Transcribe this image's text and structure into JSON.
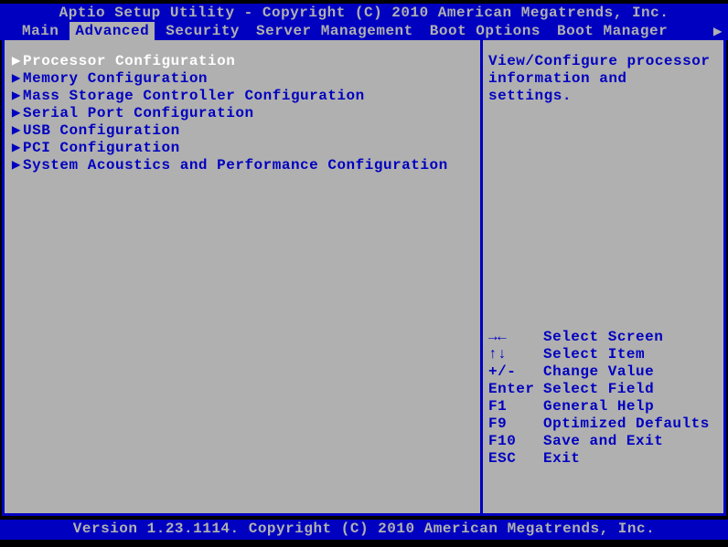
{
  "header": {
    "title": "Aptio Setup Utility - Copyright (C) 2010 American Megatrends, Inc."
  },
  "tabs": [
    {
      "label": "Main",
      "active": false
    },
    {
      "label": "Advanced",
      "active": true
    },
    {
      "label": "Security",
      "active": false
    },
    {
      "label": "Server Management",
      "active": false
    },
    {
      "label": "Boot Options",
      "active": false
    },
    {
      "label": "Boot Manager",
      "active": false
    }
  ],
  "tab_scroll_indicator": "▶",
  "menu": {
    "items": [
      {
        "label": "Processor Configuration",
        "selected": true
      },
      {
        "label": "Memory Configuration",
        "selected": false
      },
      {
        "label": "Mass Storage Controller Configuration",
        "selected": false
      },
      {
        "label": "Serial Port Configuration",
        "selected": false
      },
      {
        "label": "USB Configuration",
        "selected": false
      },
      {
        "label": "PCI Configuration",
        "selected": false
      },
      {
        "label": "System Acoustics and Performance Configuration",
        "selected": false
      }
    ],
    "arrow": "▶"
  },
  "help": {
    "line1": "View/Configure processor",
    "line2": "information and settings."
  },
  "keys": [
    {
      "key": "→←",
      "label": "Select Screen"
    },
    {
      "key": "↑↓",
      "label": "Select Item"
    },
    {
      "key": "+/-",
      "label": "Change Value"
    },
    {
      "key": "Enter",
      "label": "Select Field"
    },
    {
      "key": "F1",
      "label": "General Help"
    },
    {
      "key": "F9",
      "label": "Optimized Defaults"
    },
    {
      "key": "F10",
      "label": "Save and Exit"
    },
    {
      "key": "ESC",
      "label": "Exit"
    }
  ],
  "footer": {
    "text": "Version 1.23.1114. Copyright (C) 2010 American Megatrends, Inc."
  }
}
